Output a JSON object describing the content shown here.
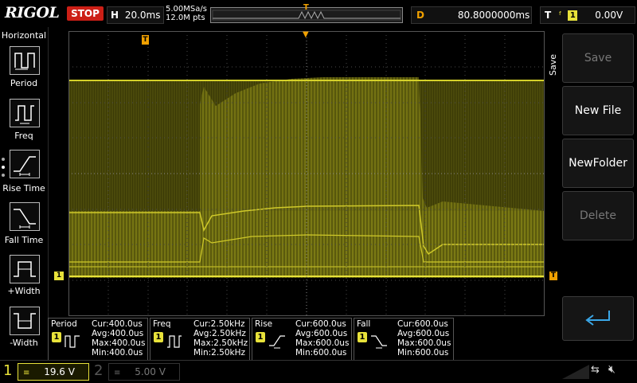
{
  "brand": "RIGOL",
  "status": "STOP",
  "horizontal": {
    "label": "H",
    "timebase": "20.0ms"
  },
  "acquisition": {
    "sample_rate": "5.00MSa/s",
    "memory_depth": "12.0M pts"
  },
  "delay": {
    "label": "D",
    "value": "80.8000000ms"
  },
  "trigger": {
    "label": "T",
    "channel": "1",
    "level": "0.00V"
  },
  "left_menu": {
    "title": "Horizontal",
    "items": [
      "Period",
      "Freq",
      "Rise Time",
      "Fall Time",
      "+Width",
      "-Width"
    ]
  },
  "right_menu": {
    "title": "Save",
    "items": [
      {
        "label": "Save",
        "enabled": false
      },
      {
        "label": "New File",
        "enabled": true
      },
      {
        "label": "NewFolder",
        "enabled": true
      },
      {
        "label": "Delete",
        "enabled": false
      }
    ]
  },
  "markers": {
    "trigger_pos": "T",
    "ch1_ground": "1"
  },
  "measurements": [
    {
      "name": "Period",
      "ch": "1",
      "cur": "Cur:400.0us",
      "avg": "Avg:400.0us",
      "max": "Max:400.0us",
      "min": "Min:400.0us"
    },
    {
      "name": "Freq",
      "ch": "1",
      "cur": "Cur:2.50kHz",
      "avg": "Avg:2.50kHz",
      "max": "Max:2.50kHz",
      "min": "Min:2.50kHz"
    },
    {
      "name": "Rise",
      "ch": "1",
      "cur": "Cur:600.0us",
      "avg": "Avg:600.0us",
      "max": "Max:600.0us",
      "min": "Min:600.0us"
    },
    {
      "name": "Fall",
      "ch": "1",
      "cur": "Cur:600.0us",
      "avg": "Avg:600.0us",
      "max": "Max:600.0us",
      "min": "Min:600.0us"
    }
  ],
  "channels": [
    {
      "num": "1",
      "scale": "19.6 V"
    },
    {
      "num": "2",
      "scale": "5.00 V"
    }
  ],
  "colors": {
    "ch1": "#e8e23a",
    "stop": "#cc1f16",
    "trigger_marker": "#f0a000"
  }
}
